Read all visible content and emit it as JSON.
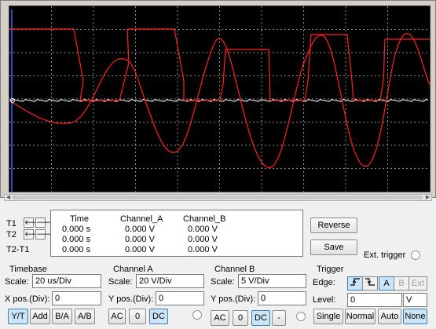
{
  "cursors": {
    "t1_label": "T1",
    "t2_label": "T2",
    "t2t1_label": "T2-T1",
    "left_arrow": "🡐",
    "right_arrow": "🡒"
  },
  "readout": {
    "headers": [
      "Time",
      "Channel_A",
      "Channel_B"
    ],
    "rows": [
      [
        "0.000 s",
        "0.000 V",
        "0.000 V"
      ],
      [
        "0.000 s",
        "0.000 V",
        "0.000 V"
      ],
      [
        "0.000 s",
        "0.000 V",
        "0.000 V"
      ]
    ]
  },
  "actions": {
    "reverse": "Reverse",
    "save": "Save",
    "ext_trigger": "Ext. trigger"
  },
  "timebase": {
    "title": "Timebase",
    "scale_label": "Scale:",
    "scale_value": "20 us/Div",
    "xpos_label": "X pos.(Div):",
    "xpos_value": "0",
    "modes": [
      "Y/T",
      "Add",
      "B/A",
      "A/B"
    ],
    "active_mode": "Y/T"
  },
  "channel_a": {
    "title": "Channel A",
    "scale_label": "Scale:",
    "scale_value": "20  V/Div",
    "ypos_label": "Y pos.(Div):",
    "ypos_value": "0",
    "coupling": [
      "AC",
      "0",
      "DC"
    ],
    "active_coupling": "DC"
  },
  "channel_b": {
    "title": "Channel B",
    "scale_label": "Scale:",
    "scale_value": "5  V/Div",
    "ypos_label": "Y pos.(Div):",
    "ypos_value": "0",
    "coupling": [
      "AC",
      "0",
      "DC",
      "-"
    ],
    "active_coupling": "DC"
  },
  "trigger": {
    "title": "Trigger",
    "edge_label": "Edge:",
    "edge_icons": [
      "rising-edge",
      "falling-edge"
    ],
    "sources": [
      "A",
      "B",
      "Ext"
    ],
    "active_source": "A",
    "level_label": "Level:",
    "level_value": "0",
    "level_unit": "V",
    "modes": [
      "Single",
      "Normal",
      "Auto",
      "None"
    ],
    "active_mode": "None"
  },
  "colors": {
    "screen_bg": "#000000",
    "grid": "#8a8a8a",
    "trace_a": "#ff2020",
    "trace_b": "#ffffff",
    "marker_blue": "#3a6bff"
  }
}
